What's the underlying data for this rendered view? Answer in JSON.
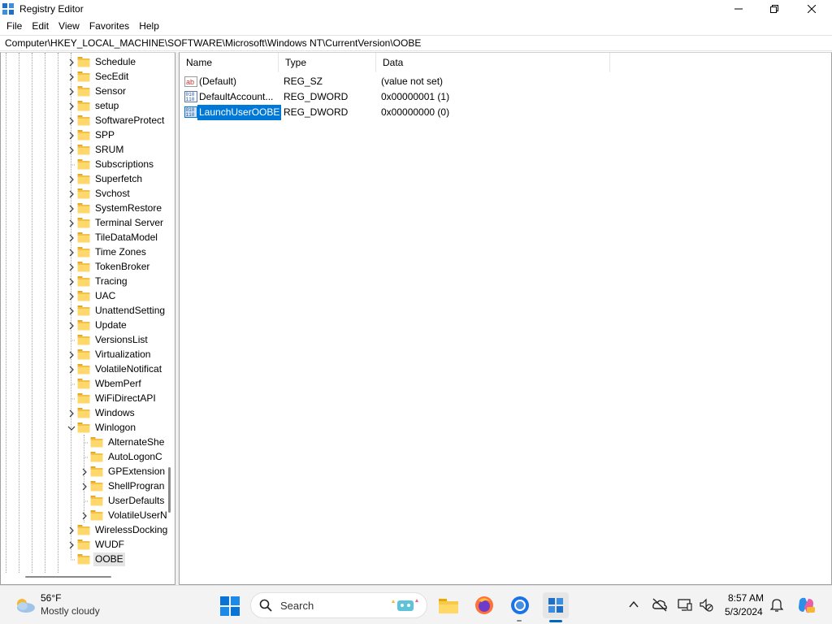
{
  "window": {
    "title": "Registry Editor"
  },
  "menu": [
    "File",
    "Edit",
    "View",
    "Favorites",
    "Help"
  ],
  "address": "Computer\\HKEY_LOCAL_MACHINE\\SOFTWARE\\Microsoft\\Windows NT\\CurrentVersion\\OOBE",
  "tree": {
    "items": [
      {
        "label": "Schedule",
        "expandable": true,
        "level": 1
      },
      {
        "label": "SecEdit",
        "expandable": true,
        "level": 1
      },
      {
        "label": "Sensor",
        "expandable": true,
        "level": 1
      },
      {
        "label": "setup",
        "expandable": true,
        "level": 1
      },
      {
        "label": "SoftwareProtect",
        "expandable": true,
        "level": 1
      },
      {
        "label": "SPP",
        "expandable": true,
        "level": 1
      },
      {
        "label": "SRUM",
        "expandable": true,
        "level": 1
      },
      {
        "label": "Subscriptions",
        "expandable": false,
        "level": 1
      },
      {
        "label": "Superfetch",
        "expandable": true,
        "level": 1
      },
      {
        "label": "Svchost",
        "expandable": true,
        "level": 1
      },
      {
        "label": "SystemRestore",
        "expandable": true,
        "level": 1
      },
      {
        "label": "Terminal Server",
        "expandable": true,
        "level": 1
      },
      {
        "label": "TileDataModel",
        "expandable": true,
        "level": 1
      },
      {
        "label": "Time Zones",
        "expandable": true,
        "level": 1
      },
      {
        "label": "TokenBroker",
        "expandable": true,
        "level": 1
      },
      {
        "label": "Tracing",
        "expandable": true,
        "level": 1
      },
      {
        "label": "UAC",
        "expandable": true,
        "level": 1
      },
      {
        "label": "UnattendSetting",
        "expandable": true,
        "level": 1
      },
      {
        "label": "Update",
        "expandable": true,
        "level": 1
      },
      {
        "label": "VersionsList",
        "expandable": false,
        "level": 1
      },
      {
        "label": "Virtualization",
        "expandable": true,
        "level": 1
      },
      {
        "label": "VolatileNotificat",
        "expandable": true,
        "level": 1
      },
      {
        "label": "WbemPerf",
        "expandable": false,
        "level": 1
      },
      {
        "label": "WiFiDirectAPI",
        "expandable": false,
        "level": 1
      },
      {
        "label": "Windows",
        "expandable": true,
        "level": 1
      },
      {
        "label": "Winlogon",
        "expandable": true,
        "expanded": true,
        "level": 1
      },
      {
        "label": "AlternateShe",
        "expandable": false,
        "level": 2
      },
      {
        "label": "AutoLogonC",
        "expandable": false,
        "level": 2
      },
      {
        "label": "GPExtension",
        "expandable": true,
        "level": 2
      },
      {
        "label": "ShellProgran",
        "expandable": true,
        "level": 2
      },
      {
        "label": "UserDefaults",
        "expandable": false,
        "level": 2
      },
      {
        "label": "VolatileUserN",
        "expandable": true,
        "level": 2
      },
      {
        "label": "WirelessDocking",
        "expandable": true,
        "level": 1
      },
      {
        "label": "WUDF",
        "expandable": true,
        "level": 1
      },
      {
        "label": "OOBE",
        "expandable": false,
        "level": 1,
        "selected": true
      }
    ]
  },
  "list": {
    "columns": [
      "Name",
      "Type",
      "Data"
    ],
    "rows": [
      {
        "name": "(Default)",
        "type": "REG_SZ",
        "data": "(value not set)",
        "icon": "string-value-icon"
      },
      {
        "name": "DefaultAccount...",
        "type": "REG_DWORD",
        "data": "0x00000001 (1)",
        "icon": "binary-value-icon"
      },
      {
        "name": "LaunchUserOOBE",
        "type": "REG_DWORD",
        "data": "0x00000000 (0)",
        "icon": "binary-value-icon",
        "selected": true
      }
    ]
  },
  "taskbar": {
    "weather_temp": "56°F",
    "weather_desc": "Mostly cloudy",
    "search_label": "Search",
    "clock_time": "8:57 AM",
    "clock_date": "5/3/2024"
  },
  "colors": {
    "selection": "#0078d7",
    "folder": "#f3c04a"
  }
}
